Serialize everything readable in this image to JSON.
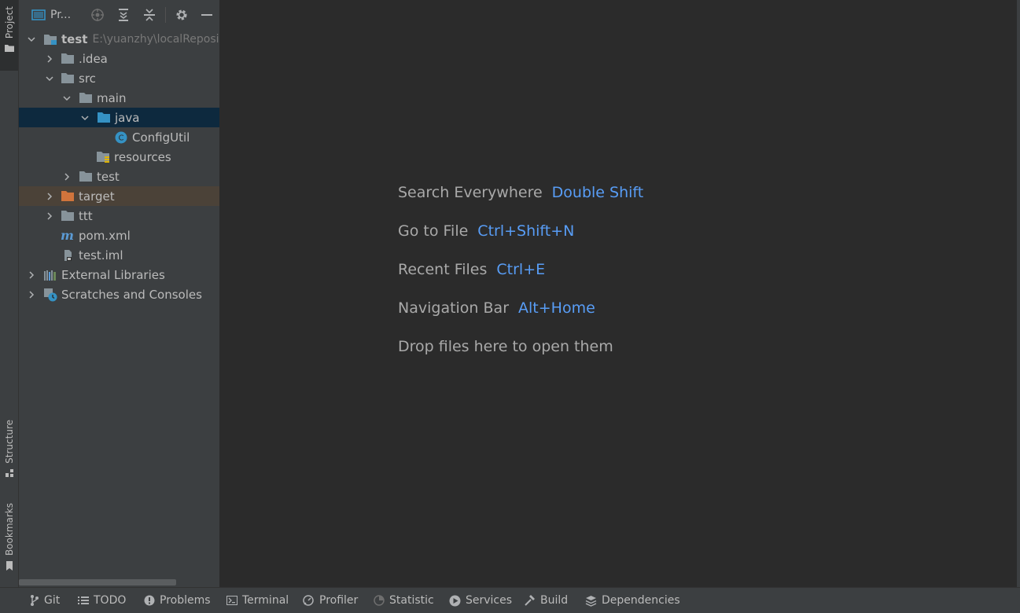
{
  "left_stripe": {
    "project_label": "Project",
    "structure_label": "Structure",
    "bookmarks_label": "Bookmarks"
  },
  "project_panel": {
    "title": "Pr...",
    "header_icons": [
      "locate-icon",
      "expand-all-icon",
      "collapse-all-icon",
      "gear-icon",
      "minimize-icon"
    ],
    "tree": [
      {
        "label": "test",
        "path": "E:\\yuanzhy\\localReposi"
      },
      {
        "label": ".idea"
      },
      {
        "label": "src"
      },
      {
        "label": "main"
      },
      {
        "label": "java"
      },
      {
        "label": "ConfigUtil"
      },
      {
        "label": "resources"
      },
      {
        "label": "test"
      },
      {
        "label": "target"
      },
      {
        "label": "ttt"
      },
      {
        "label": "pom.xml"
      },
      {
        "label": "test.iml"
      },
      {
        "label": "External Libraries"
      },
      {
        "label": "Scratches and Consoles"
      }
    ]
  },
  "editor": {
    "hints": [
      {
        "text": "Search Everywhere",
        "shortcut": "Double Shift"
      },
      {
        "text": "Go to File",
        "shortcut": "Ctrl+Shift+N"
      },
      {
        "text": "Recent Files",
        "shortcut": "Ctrl+E"
      },
      {
        "text": "Navigation Bar",
        "shortcut": "Alt+Home"
      },
      {
        "text": "Drop files here to open them",
        "shortcut": ""
      }
    ]
  },
  "bottom_bar": {
    "items": [
      "Git",
      "TODO",
      "Problems",
      "Terminal",
      "Profiler",
      "Statistic",
      "Services",
      "Build",
      "Dependencies"
    ]
  },
  "colors": {
    "background": "#2b2b2b",
    "panel": "#3c3f41",
    "selection": "#0d293e",
    "excluded": "#4b4238",
    "shortcut": "#589df6",
    "folder": "#87939a",
    "source_folder": "#3592c4",
    "excluded_folder": "#d0743c"
  }
}
